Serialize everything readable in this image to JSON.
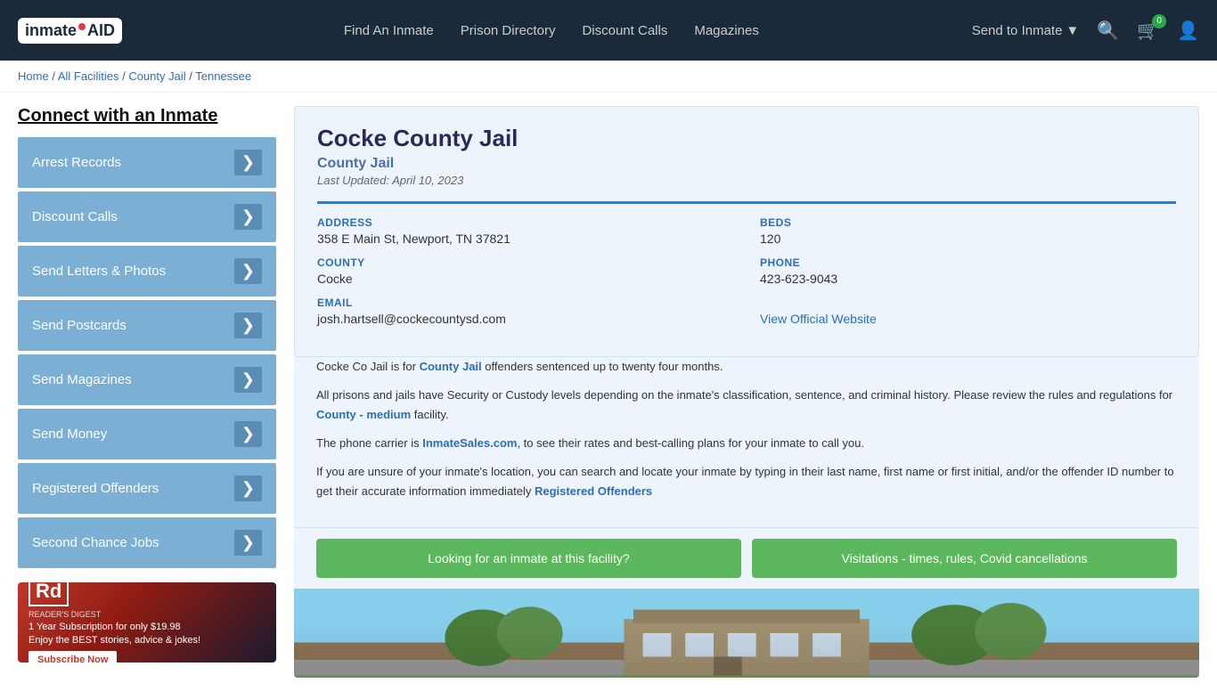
{
  "nav": {
    "logo_text": "inmateAID",
    "links": [
      {
        "id": "find-inmate",
        "label": "Find An Inmate"
      },
      {
        "id": "prison-directory",
        "label": "Prison Directory"
      },
      {
        "id": "discount-calls",
        "label": "Discount Calls"
      },
      {
        "id": "magazines",
        "label": "Magazines"
      },
      {
        "id": "send-to-inmate",
        "label": "Send to Inmate"
      }
    ],
    "cart_count": "0",
    "send_to_inmate_label": "Send to Inmate"
  },
  "breadcrumb": {
    "items": [
      "Home",
      "All Facilities",
      "County Jail",
      "Tennessee"
    ]
  },
  "sidebar": {
    "connect_title": "Connect with an Inmate",
    "menu_items": [
      {
        "id": "arrest-records",
        "label": "Arrest Records"
      },
      {
        "id": "discount-calls",
        "label": "Discount Calls"
      },
      {
        "id": "send-letters-photos",
        "label": "Send Letters & Photos"
      },
      {
        "id": "send-postcards",
        "label": "Send Postcards"
      },
      {
        "id": "send-magazines",
        "label": "Send Magazines"
      },
      {
        "id": "send-money",
        "label": "Send Money"
      },
      {
        "id": "registered-offenders",
        "label": "Registered Offenders"
      },
      {
        "id": "second-chance-jobs",
        "label": "Second Chance Jobs"
      }
    ],
    "ad": {
      "logo": "Rd",
      "brand": "READER'S DIGEST",
      "text": "1 Year Subscription for only $19.98\nEnjoy the BEST stories, advice & jokes!",
      "button": "Subscribe Now"
    }
  },
  "facility": {
    "name": "Cocke County Jail",
    "type": "County Jail",
    "last_updated": "Last Updated: April 10, 2023",
    "address_label": "ADDRESS",
    "address_value": "358 E Main St, Newport, TN 37821",
    "beds_label": "BEDS",
    "beds_value": "120",
    "county_label": "COUNTY",
    "county_value": "Cocke",
    "phone_label": "PHONE",
    "phone_value": "423-623-9043",
    "email_label": "EMAIL",
    "email_value": "josh.hartsell@cockecountysd.com",
    "website_label": "View Official Website",
    "website_url": "#",
    "description_1": "Cocke Co Jail is for County Jail offenders sentenced up to twenty four months.",
    "description_2": "All prisons and jails have Security or Custody levels depending on the inmate's classification, sentence, and criminal history. Please review the rules and regulations for County - medium facility.",
    "description_3": "The phone carrier is InmateSales.com, to see their rates and best-calling plans for your inmate to call you.",
    "description_4": "If you are unsure of your inmate's location, you can search and locate your inmate by typing in their last name, first name or first initial, and/or the offender ID number to get their accurate information immediately Registered Offenders",
    "btn_looking": "Looking for an inmate at this facility?",
    "btn_visitations": "Visitations - times, rules, Covid cancellations"
  }
}
